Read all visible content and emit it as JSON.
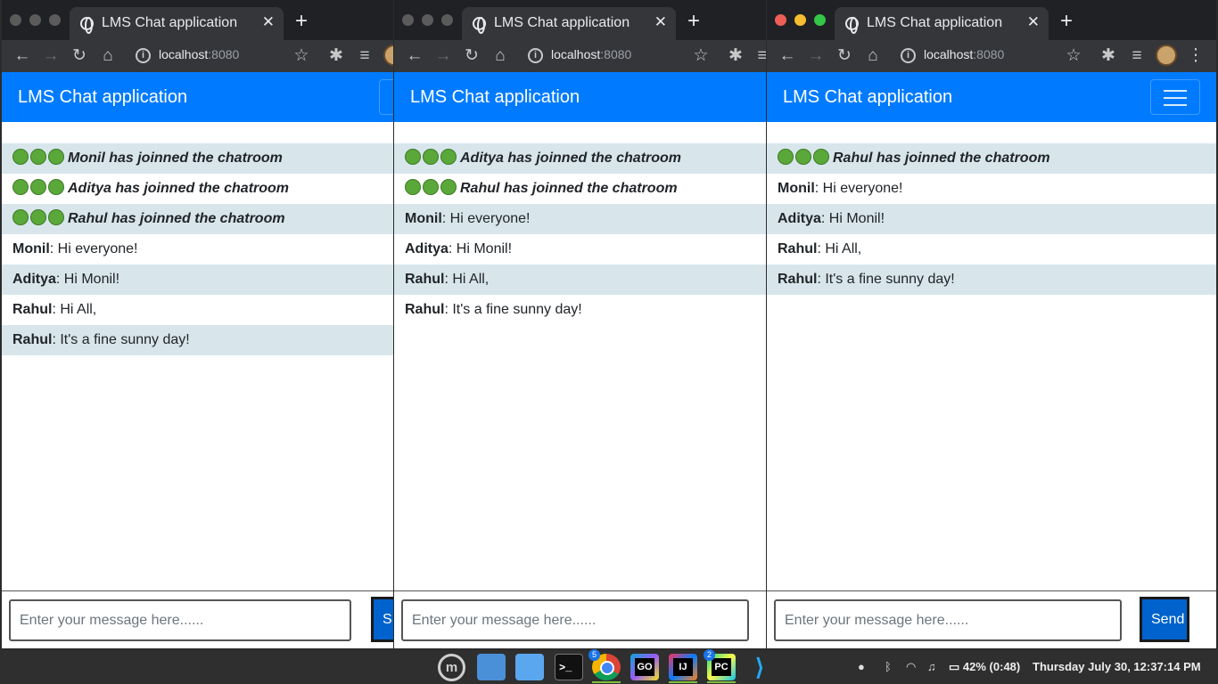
{
  "tab_title": "LMS Chat application",
  "url_host": "localhost",
  "url_port": ":8080",
  "brand": "LMS Chat application",
  "input_placeholder": "Enter your message here......",
  "send_label": "Send",
  "join_suffix": "has joinned the chatroom",
  "colors": {
    "navbar": "#007bff",
    "row_alt": "#d8e6ec",
    "send_button": "#0062cc"
  },
  "windows": [
    {
      "name": "Monil",
      "messages": [
        {
          "type": "join",
          "user": "Monil",
          "text": "has joinned the chatroom"
        },
        {
          "type": "join",
          "user": "Aditya",
          "text": "has joinned the chatroom"
        },
        {
          "type": "join",
          "user": "Rahul",
          "text": "has joinned the chatroom"
        },
        {
          "type": "chat",
          "user": "Monil",
          "text": ": Hi everyone!"
        },
        {
          "type": "chat",
          "user": "Aditya",
          "text": ": Hi Monil!"
        },
        {
          "type": "chat",
          "user": "Rahul",
          "text": ": Hi All,"
        },
        {
          "type": "chat",
          "user": "Rahul",
          "text": ": It's a fine sunny day!"
        }
      ],
      "send_visible": "S"
    },
    {
      "name": "Aditya",
      "messages": [
        {
          "type": "join",
          "user": "Aditya",
          "text": "has joinned the chatroom"
        },
        {
          "type": "join",
          "user": "Rahul",
          "text": "has joinned the chatroom"
        },
        {
          "type": "chat",
          "user": "Monil",
          "text": ": Hi everyone!"
        },
        {
          "type": "chat",
          "user": "Aditya",
          "text": ": Hi Monil!"
        },
        {
          "type": "chat",
          "user": "Rahul",
          "text": ": Hi All,"
        },
        {
          "type": "chat",
          "user": "Rahul",
          "text": ": It's a fine sunny day!"
        }
      ]
    },
    {
      "name": "Rahul",
      "messages": [
        {
          "type": "join",
          "user": "Rahul",
          "text": "has joinned the chatroom"
        },
        {
          "type": "chat",
          "user": "Monil",
          "text": ": Hi everyone!"
        },
        {
          "type": "chat",
          "user": "Aditya",
          "text": ": Hi Monil!"
        },
        {
          "type": "chat",
          "user": "Rahul",
          "text": ": Hi All,"
        },
        {
          "type": "chat",
          "user": "Rahul",
          "text": ": It's a fine sunny day!"
        }
      ],
      "send_visible": "Send"
    }
  ],
  "taskbar": {
    "apps": [
      "mint-menu",
      "files",
      "folder",
      "terminal",
      "chrome",
      "goland",
      "intellij",
      "pycharm",
      "vscode"
    ],
    "chrome_badge": "5",
    "pycharm_badge": "2",
    "terminal_label": ">_",
    "goland_label": "GO",
    "intellij_label": "IJ",
    "pycharm_label": "PC",
    "battery": "42% (0:48)",
    "clock": "Thursday July 30, 12:37:14 PM"
  }
}
